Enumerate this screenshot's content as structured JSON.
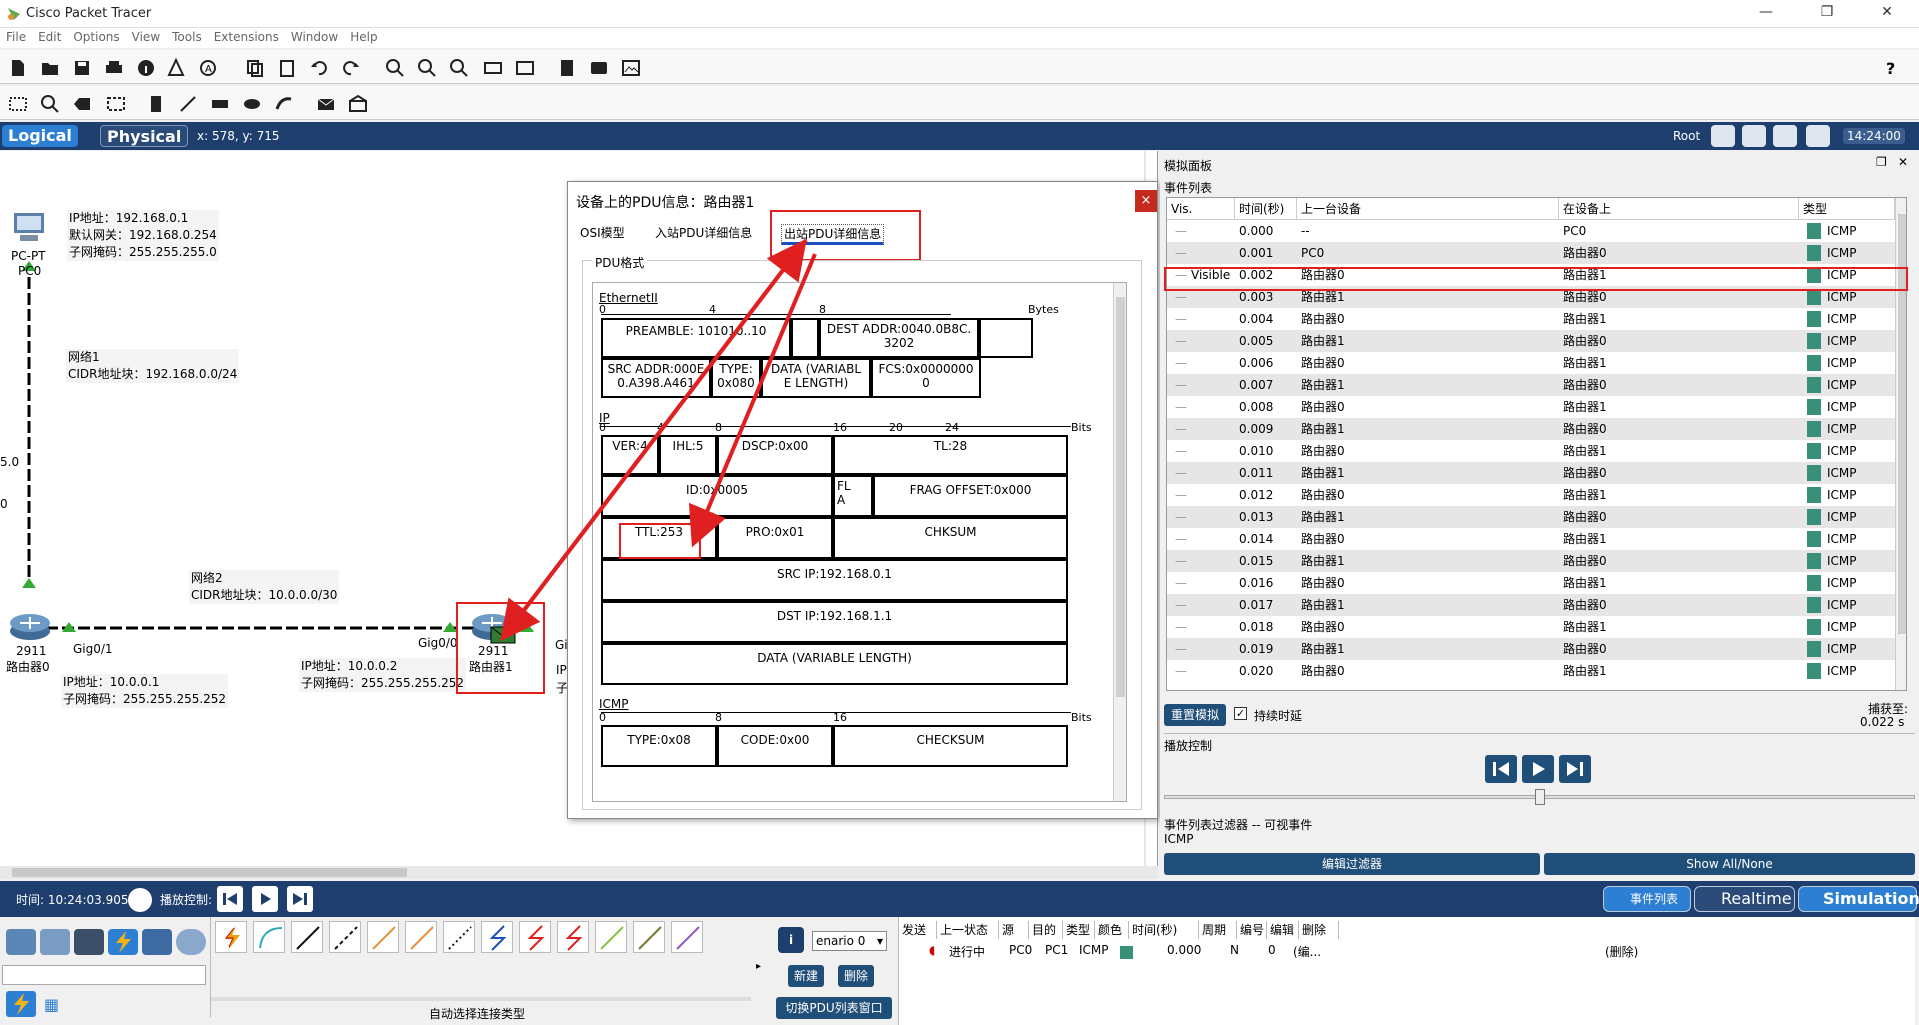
{
  "window": {
    "title": "Cisco Packet Tracer"
  },
  "menu": [
    "File",
    "Edit",
    "Options",
    "View",
    "Tools",
    "Extensions",
    "Window",
    "Help"
  ],
  "view": {
    "logical_label": "Logical",
    "physical_label": "Physical",
    "coords": "x: 578, y: 715",
    "root_label": "Root",
    "clock": "14:24:00"
  },
  "canvas": {
    "pc_label_model": "PC-PT",
    "pc_label_name": "PC0",
    "pc_info": "IP地址：192.168.0.1\n默认网关：192.168.0.254\n子网掩码：255.255.255.0",
    "net1": "网络1\nCIDR地址块：192.168.0.0/24",
    "net2": "网络2\nCIDR地址块：10.0.0.0/30",
    "r0_model": "2911",
    "r0_name": "路由器0",
    "r0_port": "Gig0/1",
    "r0_info": "IP地址：10.0.0.1\n子网掩码：255.255.255.252",
    "r1_model": "2911",
    "r1_name": "路由器1",
    "r1_port": "Gig0/0",
    "r1_port2": "Gi",
    "r1_ip_frag": "IP",
    "r1_mask_frag": "子",
    "r1_info": "IP地址：10.0.0.2\n子网掩码：255.255.255.252",
    "left_cut1": "5.0",
    "left_cut2": "0"
  },
  "pdu_dialog": {
    "title": "设备上的PDU信息：路由器1",
    "close": "×",
    "tabs": [
      "OSI模型",
      "入站PDU详细信息",
      "出站PDU详细信息"
    ],
    "legend": "PDU格式",
    "ethernet": {
      "name": "EthernetII",
      "ruler": [
        "0",
        "4",
        "8"
      ],
      "unit": "Bytes",
      "preamble": "PREAMBLE: 101010..10",
      "dest": "DEST ADDR:0040.0B8C.\n3202",
      "src": "SRC ADDR:000E\n0.A398.A461",
      "type": "TYPE:\n0x080",
      "data": "DATA (VARIABL\nE LENGTH)",
      "fcs": "FCS:0x0000000\n0"
    },
    "ip": {
      "name": "IP",
      "ruler": [
        "0",
        "4",
        "8",
        "16",
        "19",
        "20",
        "24"
      ],
      "unit": "Bits",
      "ver": "VER:4",
      "ihl": "IHL:5",
      "dscp": "DSCP:0x00",
      "tl": "TL:28",
      "id": "ID:0x0005",
      "flags": "FL\nA",
      "frag": "FRAG OFFSET:0x000",
      "ttl": "TTL:253",
      "pro": "PRO:0x01",
      "chksum": "CHKSUM",
      "src": "SRC IP:192.168.0.1",
      "dst": "DST IP:192.168.1.1",
      "data": "DATA (VARIABLE LENGTH)"
    },
    "icmp": {
      "name": "ICMP",
      "ruler": [
        "0",
        "8",
        "16"
      ],
      "unit": "Bits",
      "type": "TYPE:0x08",
      "code": "CODE:0x00",
      "checksum": "CHECKSUM"
    }
  },
  "sim_panel": {
    "title": "模拟面板",
    "event_list_label": "事件列表",
    "columns": [
      "Vis.",
      "时间(秒)",
      "上一台设备",
      "在设备上",
      "类型"
    ],
    "events": [
      {
        "vis": "",
        "time": "0.000",
        "prev": "--",
        "at": "PC0",
        "type": "ICMP"
      },
      {
        "vis": "",
        "time": "0.001",
        "prev": "PC0",
        "at": "路由器0",
        "type": "ICMP"
      },
      {
        "vis": "Visible",
        "time": "0.002",
        "prev": "路由器0",
        "at": "路由器1",
        "type": "ICMP"
      },
      {
        "vis": "",
        "time": "0.003",
        "prev": "路由器1",
        "at": "路由器0",
        "type": "ICMP"
      },
      {
        "vis": "",
        "time": "0.004",
        "prev": "路由器0",
        "at": "路由器1",
        "type": "ICMP"
      },
      {
        "vis": "",
        "time": "0.005",
        "prev": "路由器1",
        "at": "路由器0",
        "type": "ICMP"
      },
      {
        "vis": "",
        "time": "0.006",
        "prev": "路由器0",
        "at": "路由器1",
        "type": "ICMP"
      },
      {
        "vis": "",
        "time": "0.007",
        "prev": "路由器1",
        "at": "路由器0",
        "type": "ICMP"
      },
      {
        "vis": "",
        "time": "0.008",
        "prev": "路由器0",
        "at": "路由器1",
        "type": "ICMP"
      },
      {
        "vis": "",
        "time": "0.009",
        "prev": "路由器1",
        "at": "路由器0",
        "type": "ICMP"
      },
      {
        "vis": "",
        "time": "0.010",
        "prev": "路由器0",
        "at": "路由器1",
        "type": "ICMP"
      },
      {
        "vis": "",
        "time": "0.011",
        "prev": "路由器1",
        "at": "路由器0",
        "type": "ICMP"
      },
      {
        "vis": "",
        "time": "0.012",
        "prev": "路由器0",
        "at": "路由器1",
        "type": "ICMP"
      },
      {
        "vis": "",
        "time": "0.013",
        "prev": "路由器1",
        "at": "路由器0",
        "type": "ICMP"
      },
      {
        "vis": "",
        "time": "0.014",
        "prev": "路由器0",
        "at": "路由器1",
        "type": "ICMP"
      },
      {
        "vis": "",
        "time": "0.015",
        "prev": "路由器1",
        "at": "路由器0",
        "type": "ICMP"
      },
      {
        "vis": "",
        "time": "0.016",
        "prev": "路由器0",
        "at": "路由器1",
        "type": "ICMP"
      },
      {
        "vis": "",
        "time": "0.017",
        "prev": "路由器1",
        "at": "路由器0",
        "type": "ICMP"
      },
      {
        "vis": "",
        "time": "0.018",
        "prev": "路由器0",
        "at": "路由器1",
        "type": "ICMP"
      },
      {
        "vis": "",
        "time": "0.019",
        "prev": "路由器1",
        "at": "路由器0",
        "type": "ICMP"
      },
      {
        "vis": "",
        "time": "0.020",
        "prev": "路由器0",
        "at": "路由器1",
        "type": "ICMP"
      }
    ],
    "event_color": "#3a8f7a",
    "reset_label": "重置模拟",
    "continuous_label": "持续时延",
    "capture_label": "捕获至:",
    "capture_value": "0.022 s",
    "playback_label": "播放控制",
    "filter_label": "事件列表过滤器 -- 可视事件",
    "filter_value": "ICMP",
    "edit_filter": "编辑过滤器",
    "show_all": "Show All/None"
  },
  "bottom": {
    "time_label": "时间: 10:24:03.905",
    "play_label": "播放控制:",
    "event_list_btn": "事件列表",
    "realtime_btn": "Realtime",
    "simulation_btn": "Simulation",
    "auto_conn": "自动选择连接类型",
    "scenario": "enario 0",
    "new_btn": "新建",
    "delete_btn": "删除",
    "toggle_pdu": "切换PDU列表窗口",
    "pdu_columns": [
      "发送",
      "上一状态",
      "源",
      "目的",
      "类型",
      "颜色",
      "时间(秒)",
      "周期",
      "编号",
      "编辑",
      "删除"
    ],
    "pdu_row": {
      "state": "进行中",
      "src": "PC0",
      "dst": "PC1",
      "type": "ICMP",
      "time": "0.000",
      "period": "N",
      "num": "0",
      "edit": "(编...",
      "delete": "(删除)"
    }
  },
  "colors": {
    "accent": "#1e3e6e",
    "red": "#e02020",
    "link": "#1b4fbf"
  }
}
